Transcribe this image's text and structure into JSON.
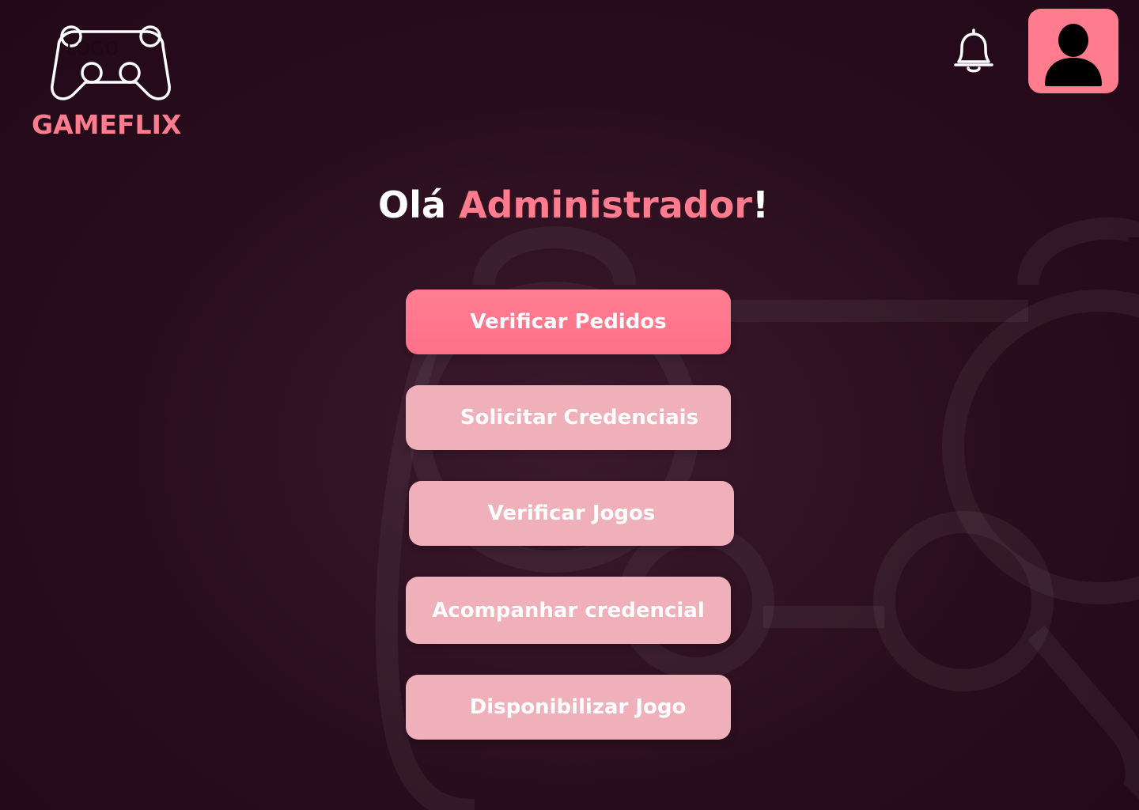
{
  "header": {
    "logo_placeholder": "LOGO",
    "brand_name": "GAMEFLIX",
    "notifications_icon": "bell-icon",
    "profile_icon": "user-icon"
  },
  "greeting": {
    "prefix": "Olá ",
    "name": "Administrador",
    "suffix": "!"
  },
  "menu": {
    "items": [
      {
        "label": "Verificar Pedidos"
      },
      {
        "label": "Solicitar Credenciais"
      },
      {
        "label": "Verificar Jogos"
      },
      {
        "label": "Acompanhar credencial"
      },
      {
        "label": "Disponibilizar Jogo"
      }
    ]
  },
  "colors": {
    "background": "#2a0d1c",
    "accent": "#ff7b8e",
    "button_secondary": "#f0b0b9",
    "text_light": "#ffffff"
  }
}
